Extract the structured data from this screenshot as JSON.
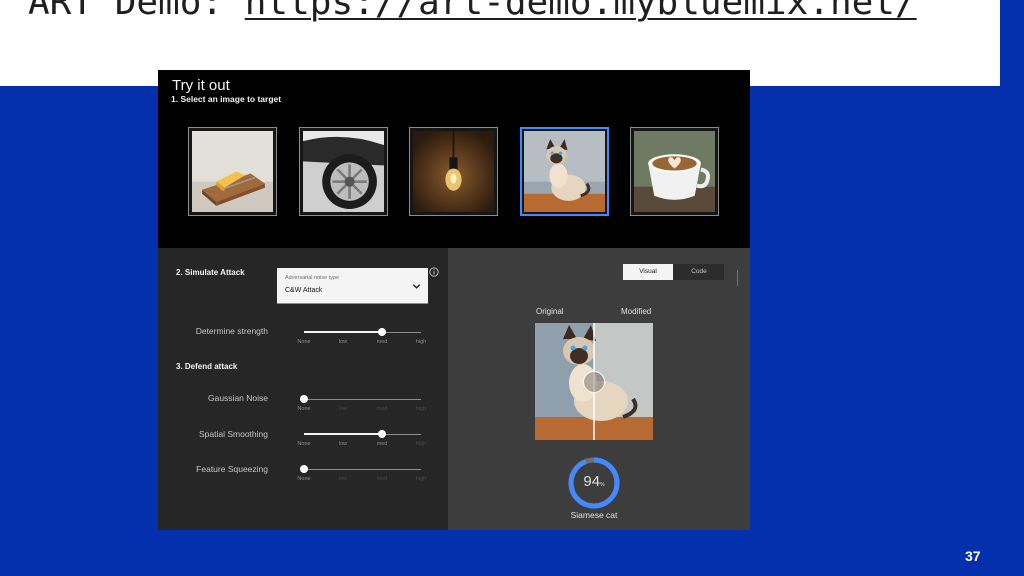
{
  "slide": {
    "title_prefix": "ART Demo: ",
    "title_link": "https://art-demo.mybluemix.net/",
    "page_number": "37"
  },
  "app": {
    "heading": "Try it out",
    "step1_label": "1. Select an image to target",
    "thumbnails": [
      {
        "name": "mousetrap",
        "selected": false
      },
      {
        "name": "car-wheel",
        "selected": false
      },
      {
        "name": "light-bulb",
        "selected": false
      },
      {
        "name": "siamese-cat",
        "selected": true
      },
      {
        "name": "latte-cup",
        "selected": false
      }
    ],
    "attack": {
      "section_label": "2. Simulate Attack",
      "dropdown_label": "Adversarial noise type",
      "dropdown_value": "C&W Attack",
      "strength_label": "Determine strength",
      "strength_level": 0.67
    },
    "defend": {
      "section_label": "3. Defend attack",
      "rows": [
        {
          "label": "Gaussian Noise",
          "level": 0
        },
        {
          "label": "Spatial Smoothing",
          "level": 0.67
        },
        {
          "label": "Feature Squeezing",
          "level": 0
        }
      ]
    },
    "slider_ticks": [
      "None",
      "low",
      "med",
      "high"
    ],
    "view_toggle": {
      "active": "Visual",
      "inactive": "Code"
    },
    "compare": {
      "original_label": "Original",
      "modified_label": "Modified",
      "split": 0.5
    },
    "result": {
      "confidence_value": "94",
      "confidence_unit": "%",
      "confidence": 0.94,
      "class_label": "Siamese cat"
    }
  },
  "colors": {
    "slide_background": "#0530ad",
    "selection_border": "#4589ff",
    "gauge_progress": "#4589ff",
    "panel_dark": "#262626",
    "panel_mid": "#3d3d3d"
  }
}
